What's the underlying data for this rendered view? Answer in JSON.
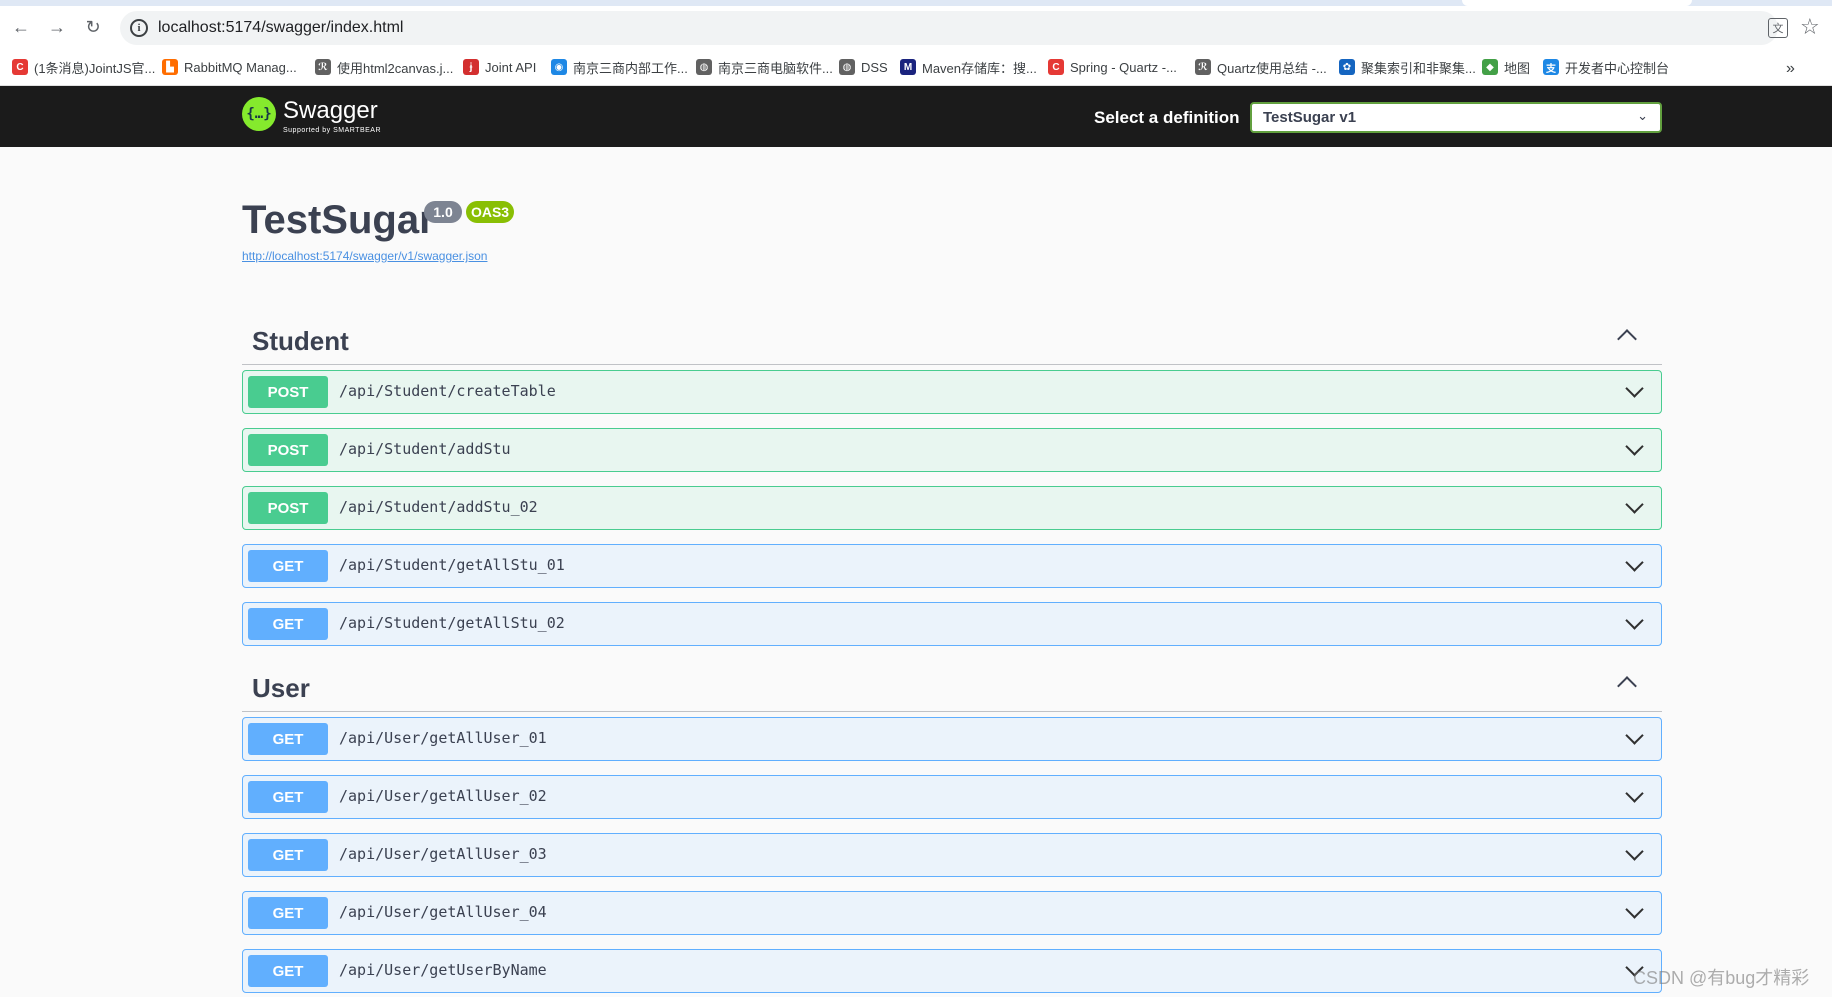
{
  "browser": {
    "url": "localhost:5174/swagger/index.html",
    "bookmarks": [
      {
        "label": "(1条消息)JointJS官...",
        "color": "#e53935",
        "glyph": "C"
      },
      {
        "label": "RabbitMQ Manag...",
        "color": "#ff6d00",
        "glyph": "▙"
      },
      {
        "label": "使用html2canvas.j...",
        "color": "#616161",
        "glyph": "ℛ"
      },
      {
        "label": "Joint API",
        "color": "#d32f2f",
        "glyph": "ɉ"
      },
      {
        "label": "南京三商内部工作...",
        "color": "#1e88e5",
        "glyph": "◉"
      },
      {
        "label": "南京三商电脑软件...",
        "color": "#616161",
        "glyph": "◍"
      },
      {
        "label": "DSS",
        "color": "#616161",
        "glyph": "◍"
      },
      {
        "label": "Maven存储库：搜...",
        "color": "#1a237e",
        "glyph": "M"
      },
      {
        "label": "Spring - Quartz -...",
        "color": "#e53935",
        "glyph": "C"
      },
      {
        "label": "Quartz使用总结 -...",
        "color": "#616161",
        "glyph": "ℛ"
      },
      {
        "label": "聚集索引和非聚集...",
        "color": "#1565c0",
        "glyph": "✿"
      },
      {
        "label": "地图",
        "color": "#43a047",
        "glyph": "◆"
      },
      {
        "label": "开发者中心控制台",
        "color": "#1e88e5",
        "glyph": "支"
      }
    ]
  },
  "header": {
    "logo_name": "Swagger",
    "logo_sub": "Supported by SMARTBEAR",
    "select_label": "Select a definition",
    "selected_definition": "TestSugar v1"
  },
  "info": {
    "title": "TestSugar",
    "version": "1.0",
    "oas": "OAS3",
    "spec_url": "http://localhost:5174/swagger/v1/swagger.json"
  },
  "tags": [
    {
      "name": "Student",
      "operations": [
        {
          "method": "POST",
          "path": "/api/Student/createTable"
        },
        {
          "method": "POST",
          "path": "/api/Student/addStu"
        },
        {
          "method": "POST",
          "path": "/api/Student/addStu_02"
        },
        {
          "method": "GET",
          "path": "/api/Student/getAllStu_01"
        },
        {
          "method": "GET",
          "path": "/api/Student/getAllStu_02"
        }
      ]
    },
    {
      "name": "User",
      "operations": [
        {
          "method": "GET",
          "path": "/api/User/getAllUser_01"
        },
        {
          "method": "GET",
          "path": "/api/User/getAllUser_02"
        },
        {
          "method": "GET",
          "path": "/api/User/getAllUser_03"
        },
        {
          "method": "GET",
          "path": "/api/User/getAllUser_04"
        },
        {
          "method": "GET",
          "path": "/api/User/getUserByName"
        }
      ]
    }
  ],
  "watermark": "CSDN @有bug才精彩"
}
